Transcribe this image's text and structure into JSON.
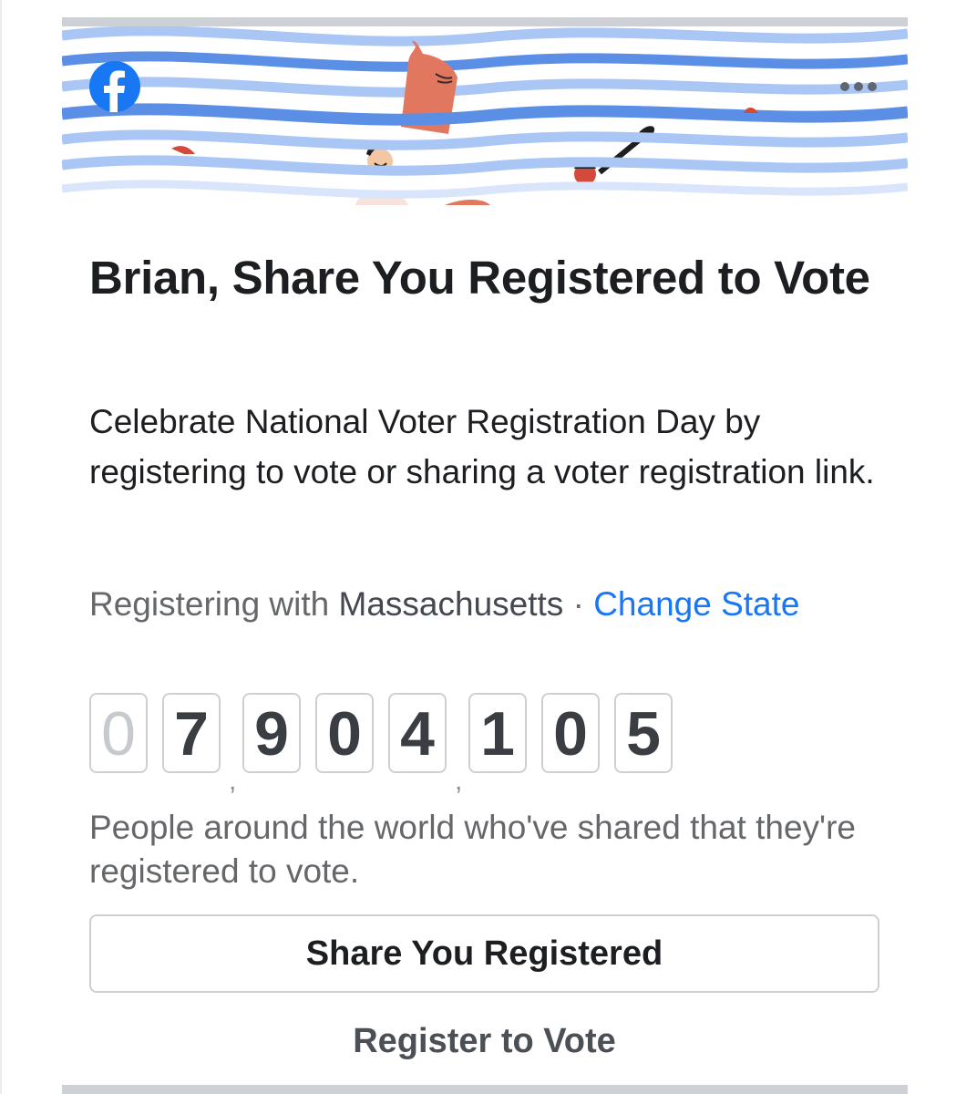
{
  "card": {
    "title": "Brian, Share You Registered to Vote",
    "description": "Celebrate National Voter Registration Day by registering to vote or sharing a voter registration link.",
    "state_prefix": "Registering with",
    "state_name": "Massachusetts",
    "state_separator": "·",
    "change_state_label": "Change State",
    "counter_digits": [
      "0",
      "7",
      "9",
      "0",
      "4",
      "1",
      "0",
      "5"
    ],
    "counter_caption": "People around the world who've shared that they're registered to vote.",
    "share_button_label": "Share You Registered",
    "register_link_label": "Register to Vote"
  },
  "icons": {
    "logo": "facebook-icon",
    "more": "more-options-icon"
  },
  "colors": {
    "link": "#1877f2",
    "wave_dark": "#5b8fe6",
    "wave_light": "#a9c6f5",
    "title_text": "#1c1e21",
    "secondary_text": "#65676b"
  }
}
